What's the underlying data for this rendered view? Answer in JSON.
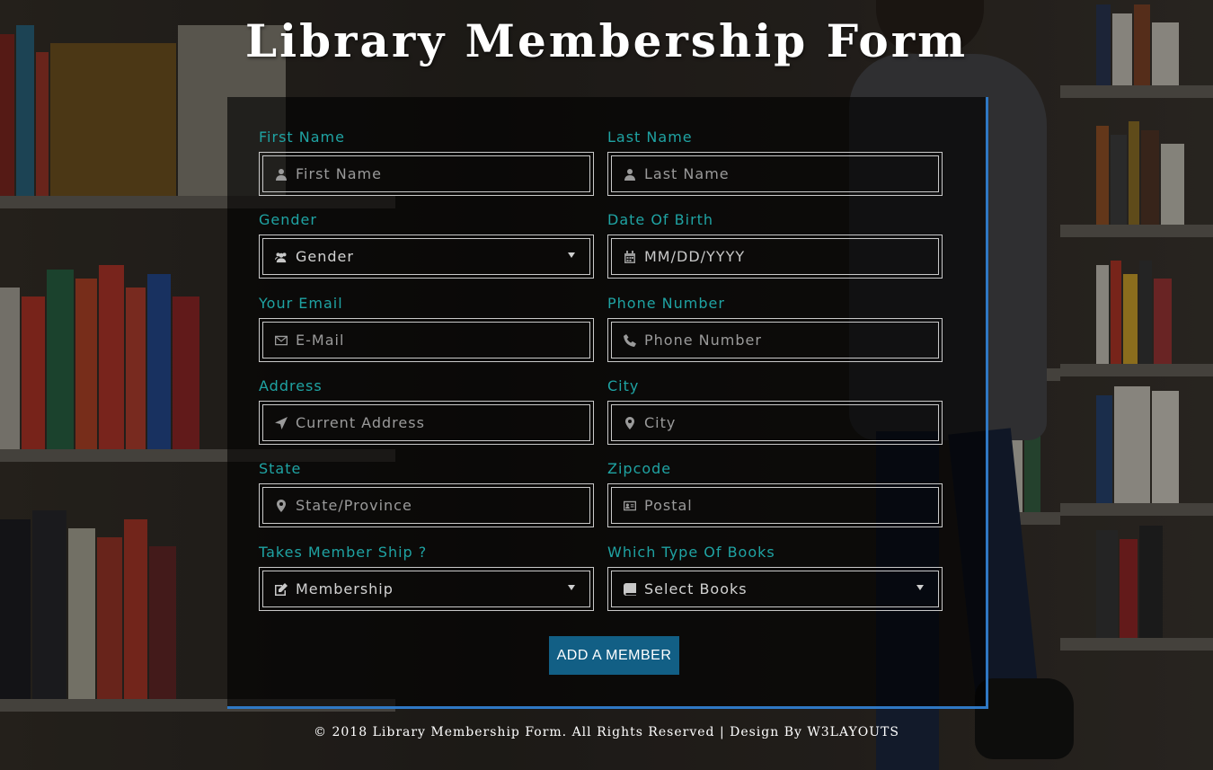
{
  "page": {
    "title": "Library Membership Form",
    "footer": "© 2018 Library Membership Form. All Rights Reserved | Design By W3LAYOUTS"
  },
  "colors": {
    "label": "#1fa3a3",
    "accent_border": "#2f78c4",
    "submit_bg": "#125f85"
  },
  "form": {
    "first_name": {
      "label": "First Name",
      "placeholder": "First Name",
      "icon": "user-icon"
    },
    "last_name": {
      "label": "Last Name",
      "placeholder": "Last Name",
      "icon": "user-icon"
    },
    "gender": {
      "label": "Gender",
      "selected": "Gender",
      "icon": "users-icon"
    },
    "dob": {
      "label": "Date Of Birth",
      "placeholder": "MM/DD/YYYY",
      "icon": "calendar-icon"
    },
    "email": {
      "label": "Your Email",
      "placeholder": "E-Mail",
      "icon": "envelope-icon"
    },
    "phone": {
      "label": "Phone Number",
      "placeholder": "Phone Number",
      "icon": "phone-icon"
    },
    "address": {
      "label": "Address",
      "placeholder": "Current Address",
      "icon": "location-arrow-icon"
    },
    "city": {
      "label": "City",
      "placeholder": "City",
      "icon": "map-marker-icon"
    },
    "state": {
      "label": "State",
      "placeholder": "State/Province",
      "icon": "map-marker-icon"
    },
    "zipcode": {
      "label": "Zipcode",
      "placeholder": "Postal",
      "icon": "address-card-icon"
    },
    "membership": {
      "label": "Takes Member Ship ?",
      "selected": "Membership",
      "icon": "edit-icon"
    },
    "books": {
      "label": "Which Type Of Books",
      "selected": "Select Books",
      "icon": "book-icon"
    },
    "submit_label": "ADD A MEMBER"
  }
}
